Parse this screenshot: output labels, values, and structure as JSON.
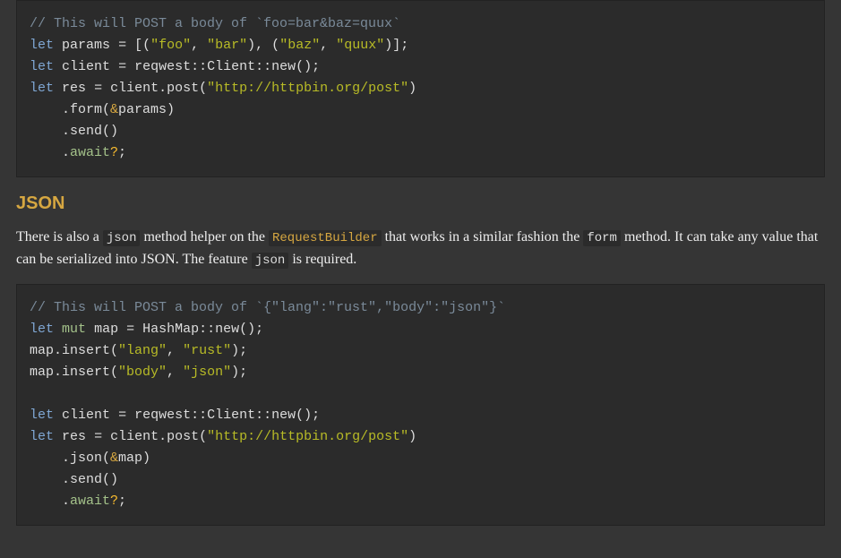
{
  "code1": {
    "comment": "// This will POST a body of `foo=bar&baz=quux`",
    "let": "let",
    "params": "params",
    "eq": "=",
    "lbr": "[(",
    "foo": "\"foo\"",
    "comma": ",",
    "bar": "\"bar\"",
    "rp1": "), (",
    "baz": "\"baz\"",
    "quux": "\"quux\"",
    "rbr": ")];",
    "client": "client",
    "reqwest_new": "reqwest::Client::new();",
    "res": "res",
    "client_post": "client.post(",
    "url": "\"http://httpbin.org/post\"",
    "close_post": ")",
    "form_open": "    .form(",
    "amp": "&",
    "params2": "params",
    "form_close": ")",
    "send": "    .send()",
    "dot": "    .",
    "await": "await",
    "q": "?",
    "semi": ";"
  },
  "section": "JSON",
  "prose": {
    "p1a": "There is also a ",
    "json": "json",
    "p1b": " method helper on the ",
    "rb": "RequestBuilder",
    "p1c": " that works in a similar fashion the ",
    "form": "form",
    "p1d": " method. It can take any value that can be serialized into JSON. The feature ",
    "jsonfeat": "json",
    "p1e": " is required."
  },
  "code2": {
    "comment": "// This will POST a body of `{\"lang\":\"rust\",\"body\":\"json\"}`",
    "let": "let",
    "mut": "mut",
    "map": "map",
    "eq": "=",
    "hashmap_new": "HashMap::new();",
    "ins1a": "map.insert(",
    "lang": "\"lang\"",
    "comma": ",",
    "rust": "\"rust\"",
    "ins_close": ");",
    "ins2a": "map.insert(",
    "body": "\"body\"",
    "json": "\"json\"",
    "client": "client",
    "reqwest_new": "reqwest::Client::new();",
    "res": "res",
    "client_post": "client.post(",
    "url": "\"http://httpbin.org/post\"",
    "close_post": ")",
    "json_open": "    .json(",
    "amp": "&",
    "map2": "map",
    "json_close": ")",
    "send": "    .send()",
    "dot": "    .",
    "await": "await",
    "q": "?",
    "semi": ";"
  }
}
